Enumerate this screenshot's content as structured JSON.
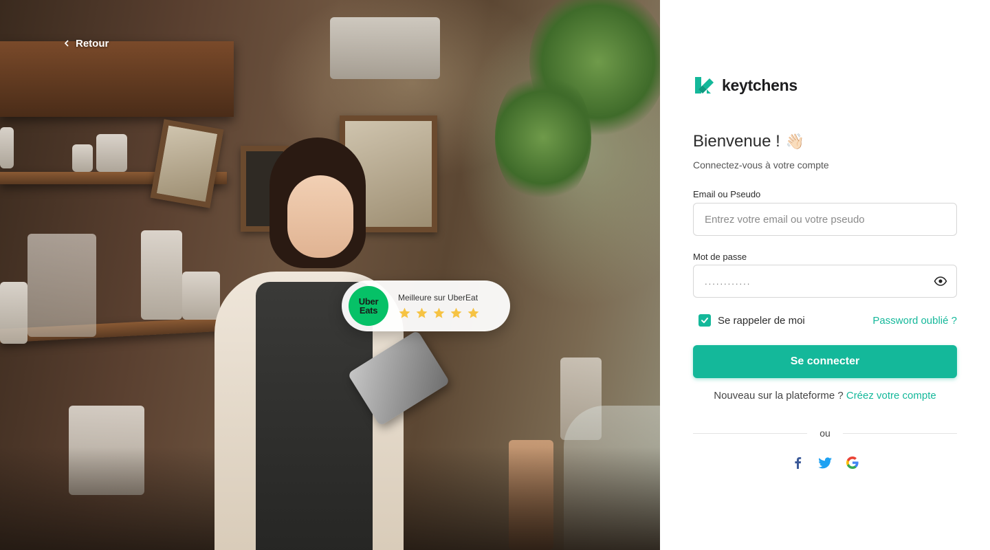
{
  "back": {
    "label": "Retour"
  },
  "rating": {
    "badge_line1": "Uber",
    "badge_line2": "Eats",
    "title": "Meilleure sur UberEat",
    "stars": 5,
    "star_color": "#f6c343"
  },
  "brand": {
    "name": "keytchens",
    "color": "#14b89a"
  },
  "login": {
    "title": "Bienvenue !",
    "emoji": "👋🏻",
    "subtitle": "Connectez-vous à votre compte",
    "email_label": "Email ou Pseudo",
    "email_placeholder": "Entrez votre email ou votre pseudo",
    "password_label": "Mot de passe",
    "password_value": "............",
    "remember_label": "Se rappeler de moi",
    "remember_checked": true,
    "forgot_label": "Password oublié ?",
    "submit_label": "Se connecter",
    "signup_prompt": "Nouveau sur la plateforme ?",
    "signup_link": "Créez votre compte",
    "divider_text": "ou"
  },
  "socials": [
    {
      "name": "facebook-icon",
      "color": "#3b5998"
    },
    {
      "name": "twitter-icon",
      "color": "#1da1f2"
    },
    {
      "name": "google-icon",
      "color": "#ea4335"
    }
  ],
  "colors": {
    "accent": "#14b89a"
  }
}
